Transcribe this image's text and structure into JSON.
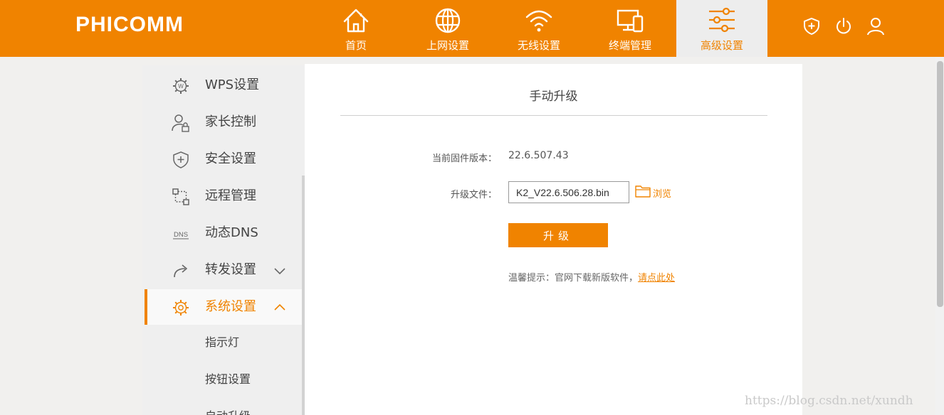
{
  "header": {
    "logo": "PHICOMM",
    "nav": [
      {
        "label": "首页",
        "icon": "home-icon",
        "active": false
      },
      {
        "label": "上网设置",
        "icon": "globe-icon",
        "active": false
      },
      {
        "label": "无线设置",
        "icon": "wifi-icon",
        "active": false
      },
      {
        "label": "终端管理",
        "icon": "devices-icon",
        "active": false
      },
      {
        "label": "高级设置",
        "icon": "sliders-icon",
        "active": true
      }
    ],
    "right_icons": [
      "shield-plus-icon",
      "power-icon",
      "user-icon"
    ]
  },
  "sidebar": {
    "items": [
      {
        "label": "WPS设置",
        "icon": "wps-gear-icon"
      },
      {
        "label": "家长控制",
        "icon": "parent-lock-icon"
      },
      {
        "label": "安全设置",
        "icon": "shield-plus-icon"
      },
      {
        "label": "远程管理",
        "icon": "remote-icon"
      },
      {
        "label": "动态DNS",
        "icon": "dns-icon"
      },
      {
        "label": "转发设置",
        "icon": "forward-icon",
        "expandable": true,
        "expanded": false
      },
      {
        "label": "系统设置",
        "icon": "system-gear-icon",
        "expandable": true,
        "expanded": true,
        "active": true
      }
    ],
    "sub_items": [
      {
        "label": "指示灯"
      },
      {
        "label": "按钮设置"
      },
      {
        "label": "自动升级"
      }
    ]
  },
  "content": {
    "title": "手动升级",
    "firmware_label": "当前固件版本：",
    "firmware_version": "22.6.507.43",
    "file_label": "升级文件：",
    "file_value": "K2_V22.6.506.28.bin",
    "browse_label": "浏览",
    "upgrade_button": "升级",
    "tip_text": "温馨提示：官网下载新版软件，",
    "tip_link": "请点此处"
  },
  "watermark": "https://blog.csdn.net/xundh",
  "colors": {
    "accent": "#f08300",
    "sidebar_bg": "#efefef",
    "page_bg": "#f1f0ee"
  }
}
